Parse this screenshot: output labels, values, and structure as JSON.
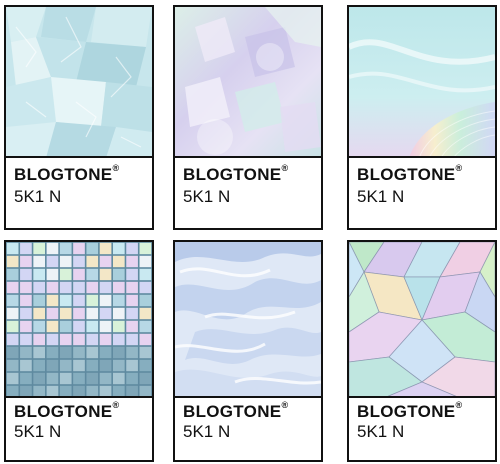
{
  "cards": [
    {
      "brand": "BLOGTONE",
      "mark": "®",
      "code": "5K1 N",
      "image": "ice-crystals-image"
    },
    {
      "brand": "BLOGTONE",
      "mark": "®",
      "code": "5K1 N",
      "image": "pastel-crystals-image"
    },
    {
      "brand": "BLOGTONE",
      "mark": "®",
      "code": "5K1 N",
      "image": "holographic-waves-image"
    },
    {
      "brand": "BLOGTONE",
      "mark": "®",
      "code": "5K1 N",
      "image": "iridescent-tiles-image"
    },
    {
      "brand": "BLOGTONE",
      "mark": "®",
      "code": "5K1 N",
      "image": "snowy-terrain-image"
    },
    {
      "brand": "BLOGTONE",
      "mark": "®",
      "code": "5K1 N",
      "image": "pastel-kaleidoscope-image"
    }
  ],
  "colors": {
    "ice": "#bfe3ea",
    "pastel_lilac": "#d6d2ee",
    "holo_teal": "#bfe6ea",
    "tile_blue": "#9fc9d6",
    "snow": "#dfe8f6",
    "kaleido_green": "#bfe8c9"
  }
}
